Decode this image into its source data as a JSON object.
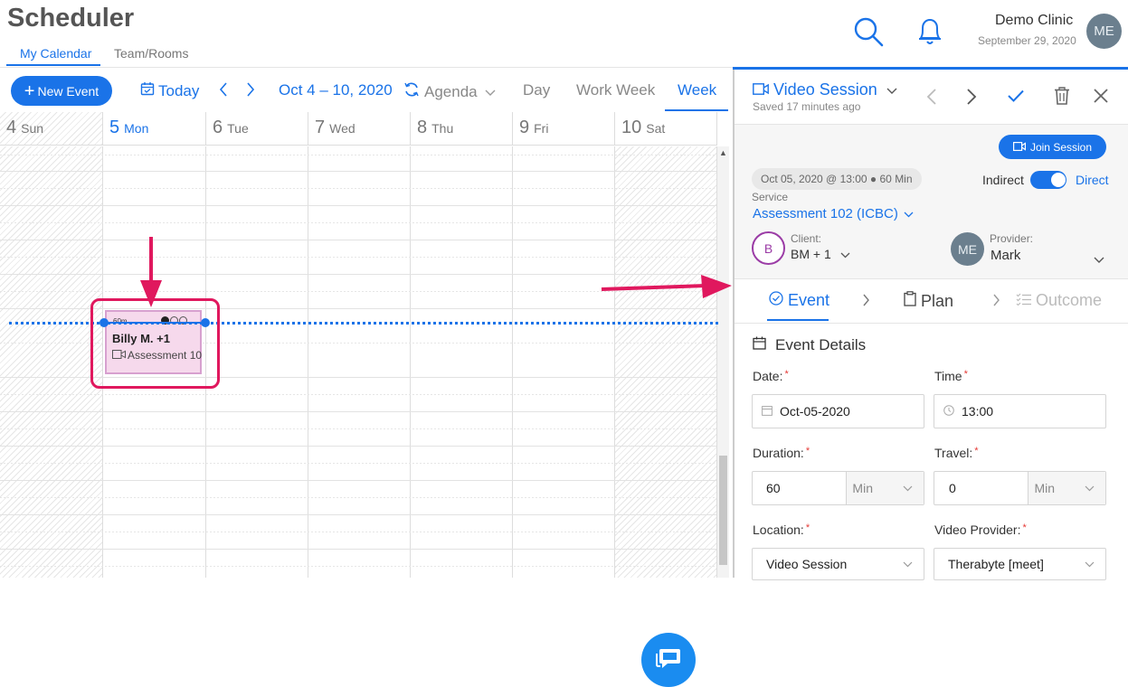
{
  "app": {
    "title": "Scheduler"
  },
  "top_tabs": [
    {
      "label": "My Calendar"
    },
    {
      "label": "Team/Rooms"
    }
  ],
  "header": {
    "clinic_name": "Demo Clinic",
    "date": "September 29, 2020",
    "avatar_initials": "ME"
  },
  "toolbar": {
    "new_event": "New Event",
    "today": "Today",
    "range": "Oct 4 – 10, 2020",
    "agenda": "Agenda",
    "views": [
      "Day",
      "Work Week",
      "Week"
    ]
  },
  "calendar": {
    "days": [
      {
        "num": "4",
        "name": "Sun"
      },
      {
        "num": "5",
        "name": "Mon"
      },
      {
        "num": "6",
        "name": "Tue"
      },
      {
        "num": "7",
        "name": "Wed"
      },
      {
        "num": "8",
        "name": "Thu"
      },
      {
        "num": "9",
        "name": "Fri"
      },
      {
        "num": "10",
        "name": "Sat"
      }
    ],
    "event": {
      "duration": "60m",
      "title": "Billy M. +1",
      "subtitle": "Assessment 10"
    }
  },
  "panel": {
    "title": "Video Session",
    "saved": "Saved 17 minutes ago",
    "join_button": "Join Session",
    "summary_pill": "Oct 05, 2020 @ 13:00 ● 60 Min",
    "indirect_label": "Indirect",
    "direct_label": "Direct",
    "service_label": "Service",
    "service_value": "Assessment 102 (ICBC)",
    "client_label": "Client:",
    "client_initial": "B",
    "client_value": "BM + 1",
    "provider_label": "Provider:",
    "provider_initials": "ME",
    "provider_value": "Mark",
    "subtabs": [
      "Event",
      "Plan",
      "Outcome"
    ],
    "section_title": "Event Details",
    "form": {
      "date_label": "Date:",
      "date_value": "Oct-05-2020",
      "time_label": "Time",
      "time_value": "13:00",
      "duration_label": "Duration:",
      "duration_value": "60",
      "duration_unit": "Min",
      "travel_label": "Travel:",
      "travel_value": "0",
      "travel_unit": "Min",
      "location_label": "Location:",
      "location_value": "Video Session",
      "video_provider_label": "Video Provider:",
      "video_provider_value": "Therabyte [meet]",
      "required_mark": "*"
    }
  },
  "colors": {
    "accent": "#1a73e8",
    "annotation": "#e0185e",
    "event_fill": "#f6d9ec"
  }
}
